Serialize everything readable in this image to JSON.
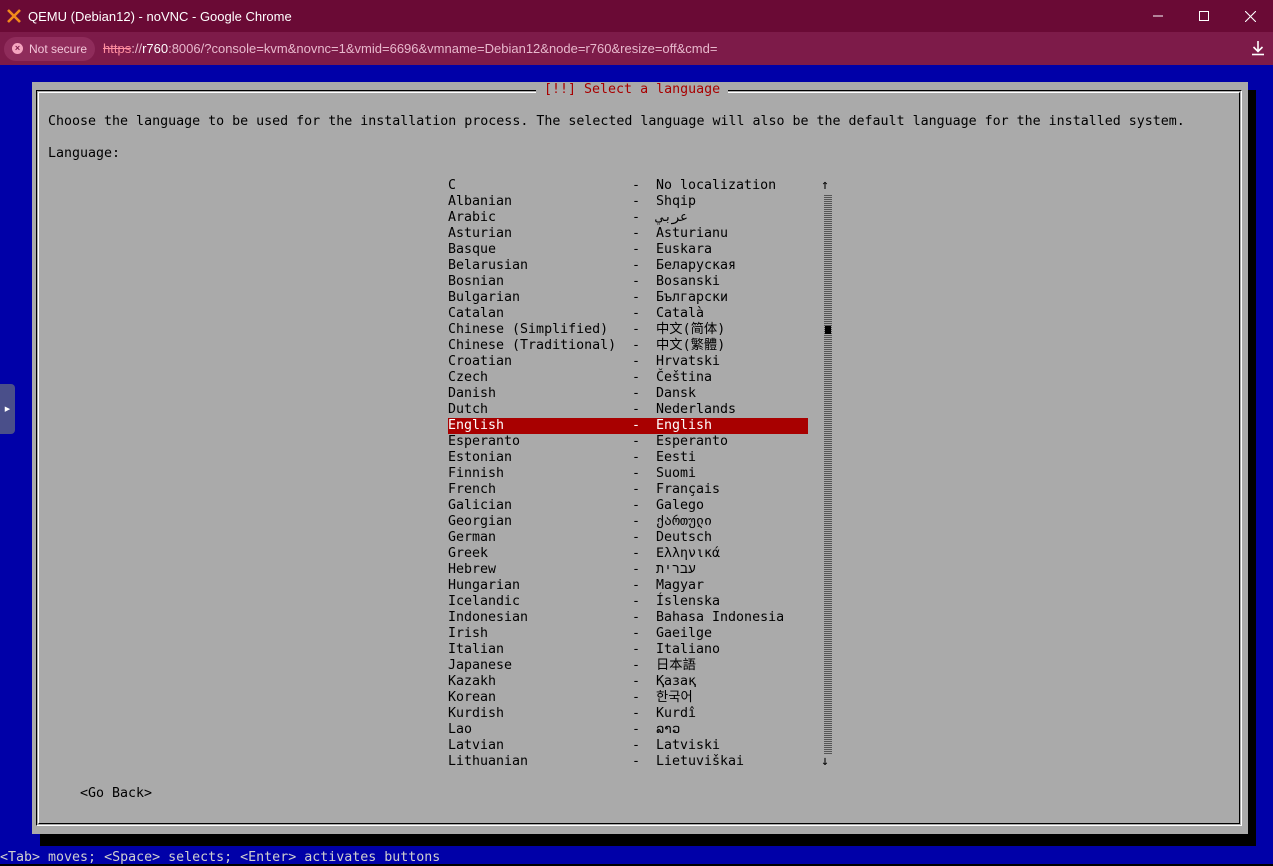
{
  "window": {
    "title": "QEMU (Debian12) - noVNC - Google Chrome",
    "minimize": "—",
    "maximize": "☐",
    "close": "✕"
  },
  "address": {
    "security_label": "Not secure",
    "url_scheme": "https",
    "url_sep": "://",
    "url_host": "r760",
    "url_rest": ":8006/?console=kvm&novnc=1&vmid=6696&vmname=Debian12&node=r760&resize=off&cmd="
  },
  "icons": {
    "logo": "proxmox-x-icon",
    "security": "not-secure-icon",
    "download": "download-icon",
    "sidebar": "expand-arrow-icon"
  },
  "colors": {
    "console_bg": "#0000a8",
    "dialog_bg": "#aaaaaa",
    "title_fg": "#a80000",
    "selected_bg": "#a80000"
  },
  "installer": {
    "dialog_title": "[!!] Select a language",
    "prompt": "Choose the language to be used for the installation process. The selected language will also be the default language for the installed system.",
    "list_label": "Language:",
    "scroll_up": "↑",
    "scroll_down": "↓",
    "go_back": "<Go Back>",
    "hint": "<Tab> moves; <Space> selects; <Enter> activates buttons",
    "selected_index": 14,
    "languages": [
      {
        "name": "C",
        "sep": "-",
        "native": "No localization"
      },
      {
        "name": "Albanian",
        "sep": "-",
        "native": "Shqip"
      },
      {
        "name": "Arabic",
        "sep": "-",
        "native": "عربي"
      },
      {
        "name": "Asturian",
        "sep": "-",
        "native": "Asturianu"
      },
      {
        "name": "Basque",
        "sep": "-",
        "native": "Euskara"
      },
      {
        "name": "Belarusian",
        "sep": "-",
        "native": "Беларуская"
      },
      {
        "name": "Bosnian",
        "sep": "-",
        "native": "Bosanski"
      },
      {
        "name": "Bulgarian",
        "sep": "-",
        "native": "Български"
      },
      {
        "name": "Catalan",
        "sep": "-",
        "native": "Català"
      },
      {
        "name": "Chinese (Simplified)",
        "sep": "-",
        "native": "中文(简体)"
      },
      {
        "name": "Chinese (Traditional)",
        "sep": "-",
        "native": "中文(繁體)"
      },
      {
        "name": "Croatian",
        "sep": "-",
        "native": "Hrvatski"
      },
      {
        "name": "Czech",
        "sep": "-",
        "native": "Čeština"
      },
      {
        "name": "Danish",
        "sep": "-",
        "native": "Dansk"
      },
      {
        "name": "Dutch",
        "sep": "-",
        "native": "Nederlands"
      },
      {
        "name": "English",
        "sep": "-",
        "native": "English"
      },
      {
        "name": "Esperanto",
        "sep": "-",
        "native": "Esperanto"
      },
      {
        "name": "Estonian",
        "sep": "-",
        "native": "Eesti"
      },
      {
        "name": "Finnish",
        "sep": "-",
        "native": "Suomi"
      },
      {
        "name": "French",
        "sep": "-",
        "native": "Français"
      },
      {
        "name": "Galician",
        "sep": "-",
        "native": "Galego"
      },
      {
        "name": "Georgian",
        "sep": "-",
        "native": "ქართული"
      },
      {
        "name": "German",
        "sep": "-",
        "native": "Deutsch"
      },
      {
        "name": "Greek",
        "sep": "-",
        "native": "Ελληνικά"
      },
      {
        "name": "Hebrew",
        "sep": "-",
        "native": "עברית"
      },
      {
        "name": "Hungarian",
        "sep": "-",
        "native": "Magyar"
      },
      {
        "name": "Icelandic",
        "sep": "-",
        "native": "Íslenska"
      },
      {
        "name": "Indonesian",
        "sep": "-",
        "native": "Bahasa Indonesia"
      },
      {
        "name": "Irish",
        "sep": "-",
        "native": "Gaeilge"
      },
      {
        "name": "Italian",
        "sep": "-",
        "native": "Italiano"
      },
      {
        "name": "Japanese",
        "sep": "-",
        "native": "日本語"
      },
      {
        "name": "Kazakh",
        "sep": "-",
        "native": "Қазақ"
      },
      {
        "name": "Korean",
        "sep": "-",
        "native": "한국어"
      },
      {
        "name": "Kurdish",
        "sep": "-",
        "native": "Kurdî"
      },
      {
        "name": "Lao",
        "sep": "-",
        "native": "ລາວ"
      },
      {
        "name": "Latvian",
        "sep": "-",
        "native": "Latviski"
      },
      {
        "name": "Lithuanian",
        "sep": "-",
        "native": "Lietuviškai"
      }
    ]
  }
}
